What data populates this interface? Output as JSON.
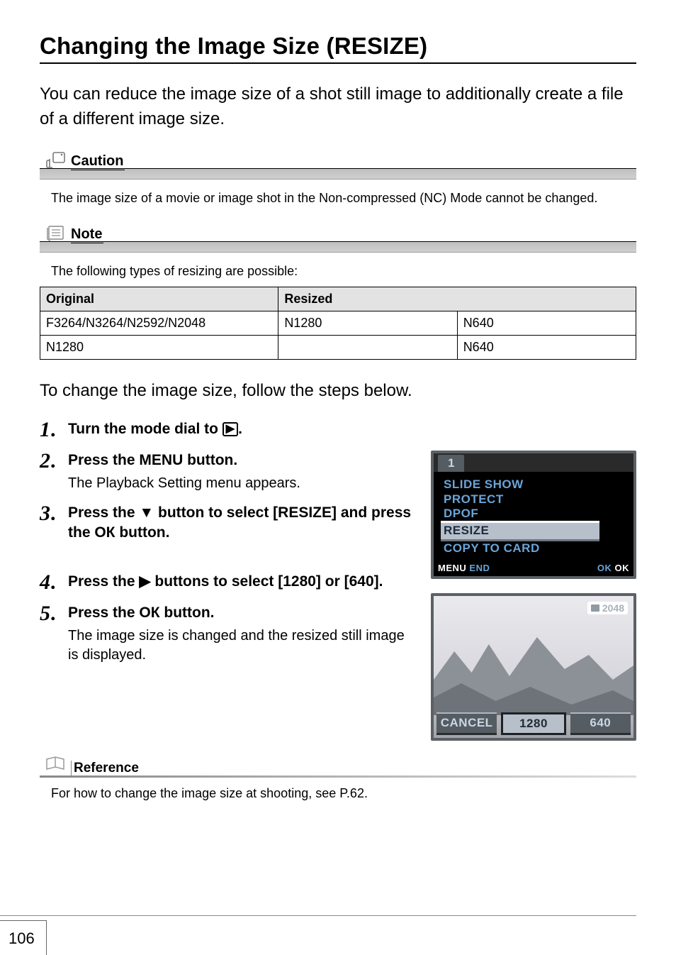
{
  "title": "Changing the Image Size (RESIZE)",
  "intro": "You can reduce the image size of a shot still image to additionally create a file of a different image size.",
  "caution": {
    "label": "Caution",
    "text": "The image size of a movie or image shot in the Non-compressed (NC) Mode cannot be changed."
  },
  "note": {
    "label": "Note",
    "text": "The following types of resizing are possible:"
  },
  "table": {
    "headers": [
      "Original",
      "Resized",
      ""
    ],
    "rows": [
      [
        "F3264/N3264/N2592/N2048",
        "N1280",
        "N640"
      ],
      [
        "N1280",
        "",
        "N640"
      ]
    ]
  },
  "lead": "To change the image size, follow the steps below.",
  "steps": [
    {
      "n": "1",
      "title_pre": "Turn the mode dial to ",
      "title_post": "."
    },
    {
      "n": "2",
      "title_pre": "Press the ",
      "sym": "M",
      "title_mid": "ENU",
      "title_post": " button.",
      "sub": "The Playback Setting menu appears."
    },
    {
      "n": "3",
      "title": "Press the ▼ button to select [RESIZE] and press the OК button."
    },
    {
      "n": "4",
      "title": "Press the ▶ buttons to select [1280] or [640]."
    },
    {
      "n": "5",
      "title_pre": "Press the ",
      "sym": "OК",
      "title_post": " button.",
      "sub": "The image size is changed and the resized still image is displayed."
    }
  ],
  "screen1": {
    "tab": "1",
    "items": [
      "SLIDE SHOW",
      "PROTECT",
      "DPOF",
      "RESIZE",
      "COPY TO CARD"
    ],
    "selectedIndex": 3,
    "footer_left_a": "MENU",
    "footer_left_b": "END",
    "footer_right_a": "OK",
    "footer_right_b": "OK"
  },
  "screen2": {
    "badge": "2048",
    "opts": [
      "CANCEL",
      "1280",
      "640"
    ],
    "selectedIndex": 1
  },
  "reference": {
    "label": "Reference",
    "text": "For how to change the image size at shooting, see P.62."
  },
  "page_number": "106"
}
